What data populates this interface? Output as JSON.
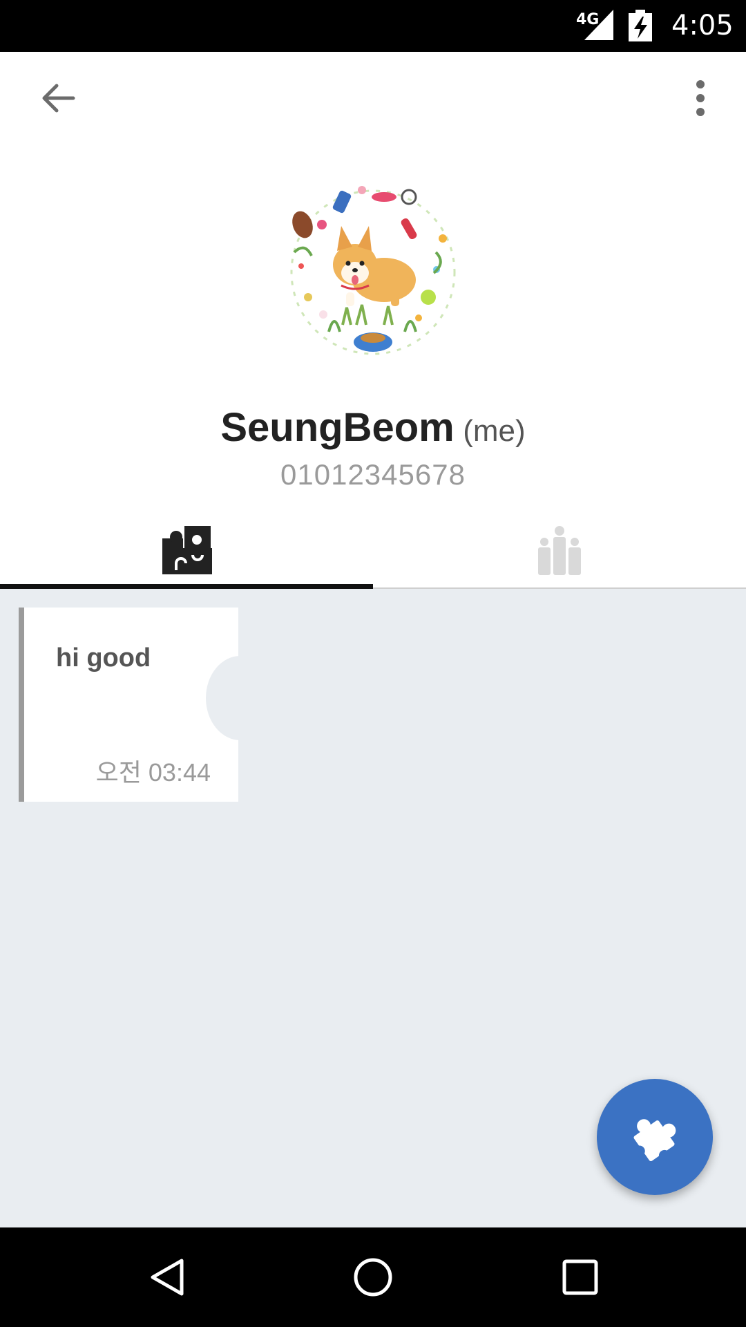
{
  "status_bar": {
    "network": "4G",
    "time": "4:05"
  },
  "header": {
    "back_icon": "arrow-left-icon",
    "more_icon": "more-vertical-icon"
  },
  "profile": {
    "name": "SeungBeom",
    "me_label": "(me)",
    "phone": "01012345678",
    "avatar": "corgi-illustration"
  },
  "tabs": [
    {
      "icon": "puzzle-icon",
      "selected": true
    },
    {
      "icon": "people-group-icon",
      "selected": false
    }
  ],
  "messages": [
    {
      "text": "hi good",
      "time": "오전 03:44"
    }
  ],
  "fab": {
    "icon": "puzzle-piece-icon"
  },
  "colors": {
    "fab": "#3b72c3",
    "content_bg": "#e9edf1",
    "tab_indicator": "#111111"
  },
  "nav_bar": {
    "back_icon": "triangle-back-icon",
    "home_icon": "circle-home-icon",
    "recents_icon": "square-recents-icon"
  }
}
